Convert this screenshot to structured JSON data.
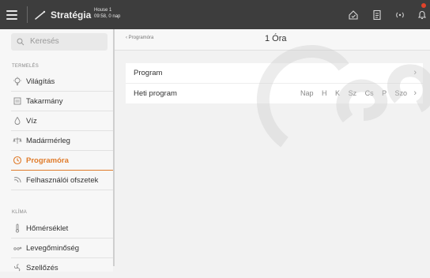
{
  "topbar": {
    "title": "Stratégia",
    "house_name": "House 1",
    "house_time": "09:58, 0 nap",
    "badge_color": "#e0432a"
  },
  "search": {
    "placeholder": "Keresés"
  },
  "sidebar": {
    "section_termeles": "TERMELÉS",
    "section_klima": "KLÍMA",
    "items_termeles": [
      {
        "label": "Világítás",
        "icon": "light-bulb-icon"
      },
      {
        "label": "Takarmány",
        "icon": "feed-icon"
      },
      {
        "label": "Víz",
        "icon": "water-drop-icon"
      },
      {
        "label": "Madármérleg",
        "icon": "scale-icon"
      },
      {
        "label": "Programóra",
        "icon": "clock-icon",
        "active": true
      },
      {
        "label": "Felhasználói ofszetek",
        "icon": "offset-icon"
      }
    ],
    "items_klima": [
      {
        "label": "Hőmérséklet",
        "icon": "thermometer-icon"
      },
      {
        "label": "Levegőminőség",
        "icon": "air-quality-icon"
      },
      {
        "label": "Szellőzés",
        "icon": "ventilation-icon"
      }
    ]
  },
  "header": {
    "back_label": "‹  Programóra",
    "page_title": "1 Óra"
  },
  "panel": {
    "rows": [
      {
        "label": "Program"
      },
      {
        "label": "Heti program"
      }
    ],
    "days": [
      "Nap",
      "H",
      "K",
      "Sz",
      "Cs",
      "P",
      "Szo"
    ],
    "chevron": "›"
  },
  "colors": {
    "accent": "#e07b2a",
    "topbar": "#3d3d3d"
  }
}
